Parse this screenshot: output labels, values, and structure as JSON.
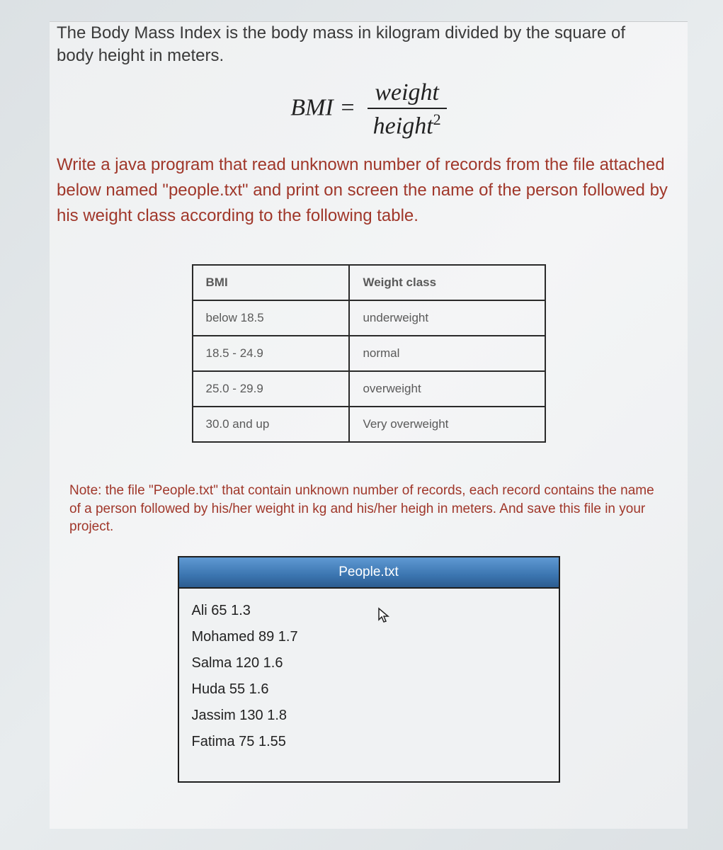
{
  "intro": "The Body Mass Index is the body mass in kilogram divided by the square of body height in meters.",
  "formula": {
    "lhs": "BMI",
    "eq": "=",
    "numerator": "weight",
    "denominator_base": "height",
    "denominator_exp": "2"
  },
  "prompt": "Write a java program that read unknown number of records from the file attached below named \"people.txt\" and print on screen the name of the person followed by his weight class according to the following table.",
  "table": {
    "headers": [
      "BMI",
      "Weight class"
    ],
    "rows": [
      [
        "below 18.5",
        "underweight"
      ],
      [
        "18.5 - 24.9",
        "normal"
      ],
      [
        "25.0 - 29.9",
        "overweight"
      ],
      [
        "30.0 and up",
        "Very overweight"
      ]
    ]
  },
  "note": "Note: the file \"People.txt\" that contain unknown number of records, each record contains the name of a person followed by his/her weight in kg and his/her heigh in meters. And save this file in your project.",
  "file": {
    "title": "People.txt",
    "lines": [
      "Ali 65 1.3",
      "Mohamed 89 1.7",
      "Salma 120 1.6",
      "Huda 55 1.6",
      "Jassim 130 1.8",
      "Fatima 75 1.55"
    ]
  },
  "cursor_glyph": "↖"
}
